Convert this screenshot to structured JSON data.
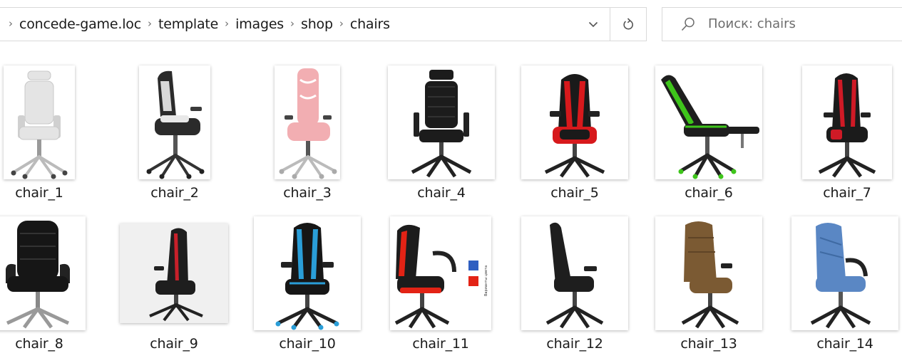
{
  "breadcrumb": {
    "segments": [
      "concede-game.loc",
      "template",
      "images",
      "shop",
      "chairs"
    ]
  },
  "search": {
    "placeholder": "Поиск: chairs"
  },
  "files": [
    {
      "name": "chair_1"
    },
    {
      "name": "chair_2"
    },
    {
      "name": "chair_3"
    },
    {
      "name": "chair_4"
    },
    {
      "name": "chair_5"
    },
    {
      "name": "chair_6"
    },
    {
      "name": "chair_7"
    },
    {
      "name": "chair_8"
    },
    {
      "name": "chair_9"
    },
    {
      "name": "chair_10"
    },
    {
      "name": "chair_11"
    },
    {
      "name": "chair_12"
    },
    {
      "name": "chair_13"
    },
    {
      "name": "chair_14"
    }
  ],
  "chair_11_tag": "Варианты цвета",
  "colors": {
    "chair_1": "#e4e4e4",
    "chair_2": "#2b2b2b",
    "chair_3": "#f2aeb2",
    "chair_4": "#1c1c1c",
    "chair_5": "#d7191c",
    "chair_6": "#3ec51b",
    "chair_7": "#cf1a26",
    "chair_8": "#161616",
    "chair_9": "#c8202a",
    "chair_10": "#2a9ed8",
    "chair_11": "#e32315",
    "chair_12": "#1e1e1e",
    "chair_13": "#7b5a33",
    "chair_14": "#5a87c4"
  }
}
